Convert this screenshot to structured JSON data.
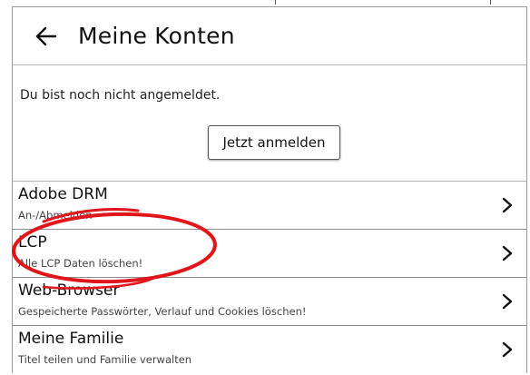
{
  "header": {
    "title": "Meine Konten",
    "back_icon": "arrow-left-icon"
  },
  "login": {
    "message": "Du bist noch nicht angemeldet.",
    "button_label": "Jetzt anmelden"
  },
  "menu": {
    "items": [
      {
        "title": "Adobe DRM",
        "subtitle": "An-/Abmelden",
        "icon": "chevron-right-icon"
      },
      {
        "title": "LCP",
        "subtitle": "Alle LCP Daten löschen!",
        "icon": "chevron-right-icon"
      },
      {
        "title": "Web-Browser",
        "subtitle": "Gespeicherte Passwörter, Verlauf und Cookies löschen!",
        "icon": "chevron-right-icon"
      },
      {
        "title": "Meine Familie",
        "subtitle": "Titel teilen und Familie verwalten",
        "icon": "chevron-right-icon"
      }
    ]
  },
  "colors": {
    "annotation": "#e0161b",
    "divider": "#b4b4b4",
    "text": "#111111"
  }
}
